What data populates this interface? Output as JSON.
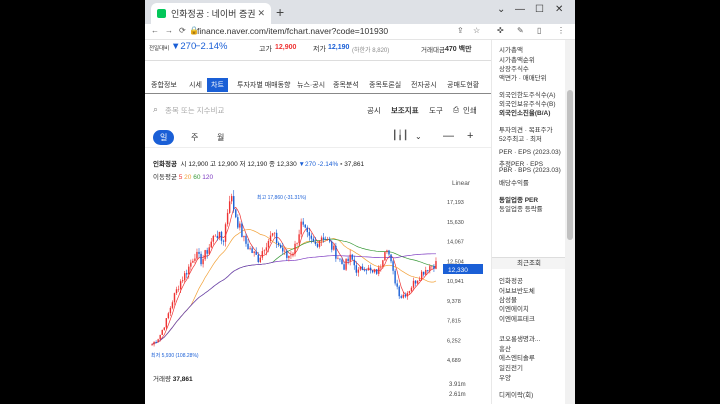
{
  "browser": {
    "tab_title": "인화정공 : 네이버 증권",
    "tab_close": "✕",
    "new_tab": "+",
    "url": "finance.naver.com/item/fchart.naver?code=101930",
    "window_controls": [
      "⌄",
      "—",
      "☐",
      "✕"
    ]
  },
  "price_strip": {
    "label": "전일대비",
    "change": "▼270",
    "change_pct": "−2.14%",
    "high_label": "고가",
    "high_value": "12,900",
    "low_label": "저가",
    "low_value": "12,190",
    "low_sub": "(하한가 8,820)",
    "amount_label": "거래대금",
    "amount_value": "470 백만"
  },
  "subnav": {
    "tabs": [
      "종합정보",
      "시세",
      "차트",
      "투자자별 매매동향",
      "뉴스·공시",
      "종목분석",
      "종목토론실",
      "전자공시",
      "공매도현황"
    ],
    "active_index": 2
  },
  "search": {
    "placeholder": "종목 또는 지수비교",
    "options": [
      "공시",
      "보조지표",
      "도구",
      "인쇄"
    ]
  },
  "periods": {
    "items": [
      "일",
      "주",
      "월"
    ],
    "selected": "일"
  },
  "chart_header": {
    "name": "인화정공",
    "open_label": "시",
    "open": "12,900",
    "high_label": "고",
    "high": "12,900",
    "low_label": "저",
    "low": "12,190",
    "close_label": "종",
    "close": "12,330",
    "change": "▼270",
    "change_pct": "-2.14%",
    "volume": "37,861",
    "ma_label": "이동평균",
    "ma_periods": [
      "5",
      "20",
      "60",
      "120"
    ],
    "scale": "Linear",
    "max_annotation": "최고 17,860 (-31.31%)",
    "min_annotation": "최저 5,930 (108.28%)",
    "current_badge": "12,330",
    "volume_label": "거래량",
    "volume_value": "37,861",
    "volume_ticks": [
      "3.91m",
      "2.61m"
    ]
  },
  "chart_data": {
    "type": "line",
    "title": "",
    "y_ticks": [
      17193,
      15630,
      14067,
      12504,
      10941,
      9378,
      7815,
      6252,
      4689
    ],
    "ylim": [
      4689,
      17193
    ],
    "series_approx": [
      5930,
      6500,
      7800,
      9600,
      10900,
      11800,
      13100,
      12500,
      13600,
      14800,
      14000,
      17860,
      15700,
      14100,
      13300,
      12700,
      13900,
      14600,
      13700,
      12800,
      13400,
      15400,
      14300,
      13800,
      14600,
      13900,
      13000,
      12100,
      12800,
      11600,
      12200,
      11500,
      11800,
      14000,
      11400,
      9700,
      10100,
      10900,
      11600,
      12100,
      12330
    ],
    "series_name": "",
    "colors": {
      "up": "#e33",
      "down": "#1a5fd6",
      "ma5": "#e33",
      "ma20": "#f2a23a",
      "ma60": "#3a9a3a",
      "ma120": "#7d3ac1"
    }
  },
  "side": {
    "items": [
      "시가총액",
      "시가총액순위",
      "상장주식수",
      "액면가 · 매매단위",
      "외국인한도주식수(A)",
      "외국인보유주식수(B)",
      "외국인소진율(B/A)",
      "투자의견 · 목표주가",
      "52주최고 · 최저",
      "PER · EPS (2023.03)",
      "추정PER · EPS",
      "PBR · BPS (2023.03)",
      "배당수익률",
      "동일업종 PER",
      "동일업종 등락률"
    ],
    "recent_header": "최근조회",
    "recent": [
      "인화정공",
      "어보브반도체",
      "삼성물",
      "이엔에이치",
      "이엔에프테크",
      "코오롱생명과...",
      "흥산",
      "에스엔티솔루",
      "일진전기",
      "우양",
      "디케이락(회)"
    ]
  }
}
